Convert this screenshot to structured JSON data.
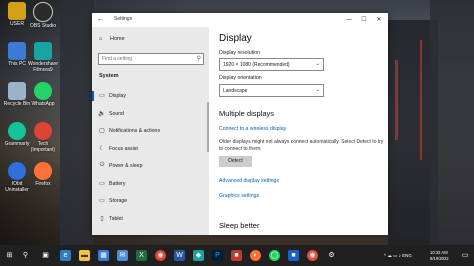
{
  "desktop": {
    "icons": [
      {
        "label": "USER",
        "color": "#d4a017"
      },
      {
        "label": "OBS Studio",
        "color": "#2b2b2b"
      },
      {
        "label": "This PC",
        "color": "#3a7bd5"
      },
      {
        "label": "Wondershare Filmora9",
        "color": "#1aa3a3"
      },
      {
        "label": "Recycle Bin",
        "color": "#9bb3c9"
      },
      {
        "label": "WhatsApp",
        "color": "#25d366"
      },
      {
        "label": "Grammarly",
        "color": "#15c39a"
      },
      {
        "label": "Tech (Important)",
        "color": "#db4437"
      },
      {
        "label": "IObit Uninstaller",
        "color": "#2f6fde"
      },
      {
        "label": "Firefox",
        "color": "#ff7139"
      }
    ]
  },
  "window": {
    "title": "Settings",
    "back_icon": "back-arrow-icon",
    "controls": {
      "minimize": "—",
      "maximize": "☐",
      "close": "✕"
    }
  },
  "sidebar": {
    "home_label": "Home",
    "search_placeholder": "Find a setting",
    "section_title": "System",
    "items": [
      {
        "label": "Display",
        "icon": "display-icon",
        "glyph": "▭"
      },
      {
        "label": "Sound",
        "icon": "sound-icon",
        "glyph": "🔈"
      },
      {
        "label": "Notifications & actions",
        "icon": "notifications-icon",
        "glyph": "▢"
      },
      {
        "label": "Focus assist",
        "icon": "focus-assist-icon",
        "glyph": "☾"
      },
      {
        "label": "Power & sleep",
        "icon": "power-icon",
        "glyph": "⏻"
      },
      {
        "label": "Battery",
        "icon": "battery-icon",
        "glyph": "▭"
      },
      {
        "label": "Storage",
        "icon": "storage-icon",
        "glyph": "▭"
      },
      {
        "label": "Tablet",
        "icon": "tablet-icon",
        "glyph": "▯"
      }
    ]
  },
  "main": {
    "title": "Display",
    "resolution_label": "Display resolution",
    "resolution_value": "1920 × 1080 (Recommended)",
    "orientation_label": "Display orientation",
    "orientation_value": "Landscape",
    "multiple_displays_title": "Multiple displays",
    "connect_link": "Connect to a wireless display",
    "detect_info": "Older displays might not always connect automatically. Select Detect to try to connect to them.",
    "detect_button": "Detect",
    "advanced_link": "Advanced display settings",
    "graphics_link": "Graphics settings",
    "sleep_title": "Sleep better"
  },
  "taskbar": {
    "time": "10:32 AM",
    "date": "9/10/2022",
    "apps": [
      {
        "icon": "start-icon",
        "color": "#202020",
        "glyph": "⊞"
      },
      {
        "icon": "search-icon",
        "color": "#202020",
        "glyph": "⚲"
      },
      {
        "icon": "task-view-icon",
        "color": "#202020",
        "glyph": "▣"
      },
      {
        "icon": "edge-icon",
        "color": "#2d7fc1",
        "glyph": "e"
      },
      {
        "icon": "file-explorer-icon",
        "color": "#f5c542",
        "glyph": "▬"
      },
      {
        "icon": "store-icon",
        "color": "#3a7bd5",
        "glyph": "▦"
      },
      {
        "icon": "mail-icon",
        "color": "#4a90d9",
        "glyph": "✉"
      },
      {
        "icon": "excel-icon",
        "color": "#1d6f42",
        "glyph": "X"
      },
      {
        "icon": "chrome-icon",
        "color": "#db4437",
        "glyph": "◉"
      },
      {
        "icon": "word-icon",
        "color": "#2b579a",
        "glyph": "W"
      },
      {
        "icon": "filmora-icon",
        "color": "#1aa3a3",
        "glyph": "◆"
      },
      {
        "icon": "photoshop-icon",
        "color": "#001e36",
        "glyph": "P"
      },
      {
        "icon": "app-icon",
        "color": "#c0392b",
        "glyph": "■"
      },
      {
        "icon": "firefox-icon",
        "color": "#ff7139",
        "glyph": "◐"
      },
      {
        "icon": "whatsapp-icon",
        "color": "#25d366",
        "glyph": "◯"
      },
      {
        "icon": "app2-icon",
        "color": "#1565c0",
        "glyph": "■"
      },
      {
        "icon": "chrome2-icon",
        "color": "#e74c3c",
        "glyph": "◉"
      },
      {
        "icon": "settings-icon",
        "color": "#202020",
        "glyph": "⚙"
      }
    ],
    "tray": "^ ☁ ▭ ♪ ENG"
  }
}
